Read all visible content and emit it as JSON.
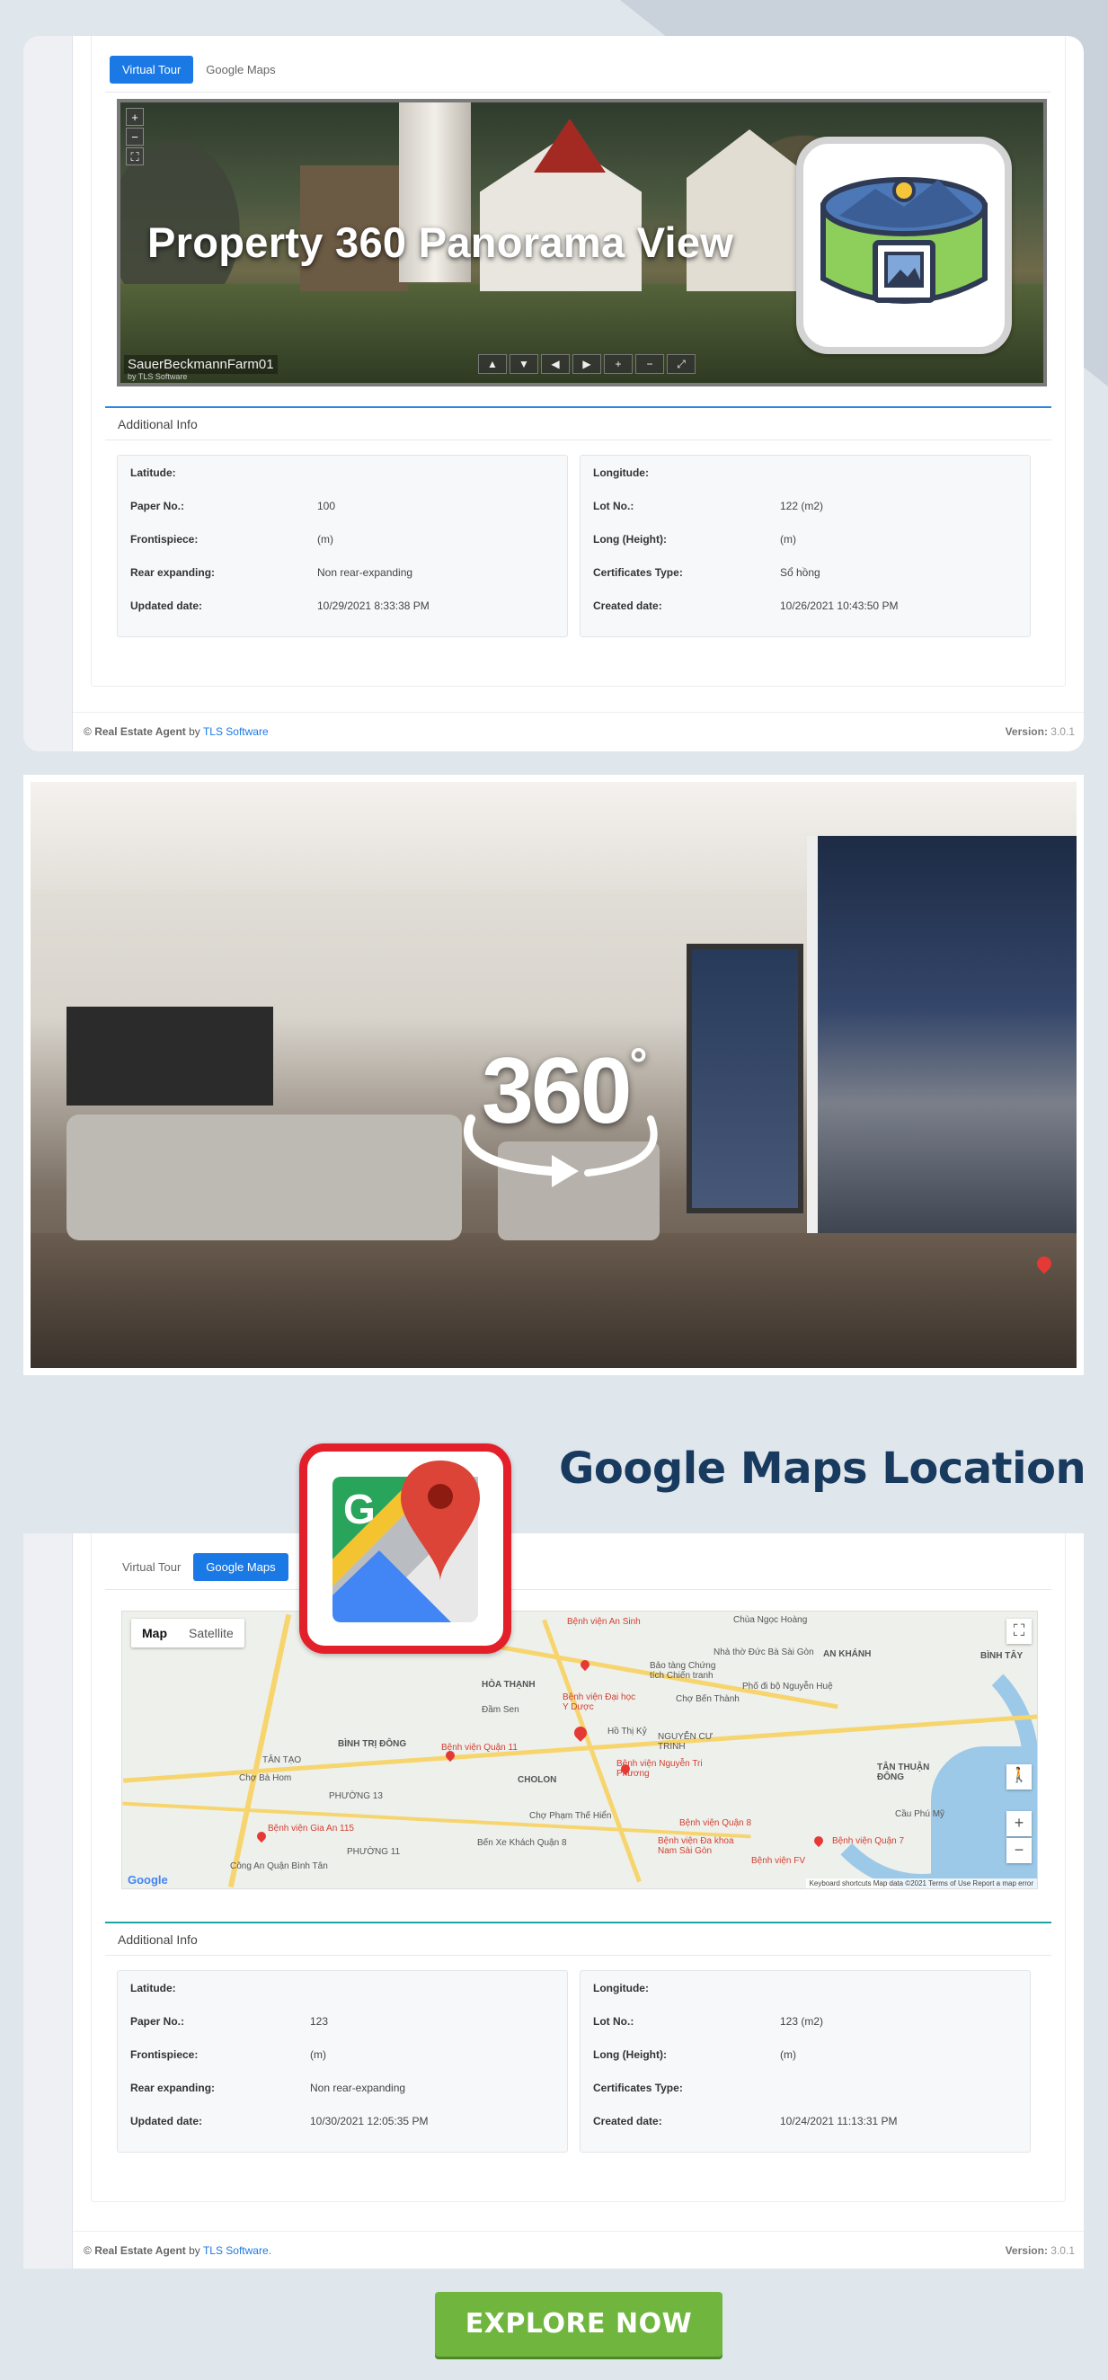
{
  "panel1": {
    "tabs": [
      {
        "label": "Virtual Tour",
        "active": true
      },
      {
        "label": "Google Maps",
        "active": false
      }
    ],
    "panorama": {
      "overlay_title": "Property 360 Panorama View",
      "scene_name": "SauerBeckmannFarm01",
      "credit": "by TLS Software",
      "zoom_buttons": [
        "+",
        "−",
        "⛶"
      ],
      "nav_buttons": [
        "▲",
        "▼",
        "◀",
        "▶",
        "+",
        "−",
        "⤢"
      ]
    },
    "section_title": "Additional Info",
    "left_info": [
      {
        "label": "Latitude:",
        "value": ""
      },
      {
        "label": "Paper No.:",
        "value": "100"
      },
      {
        "label": "Frontispiece:",
        "value": "(m)"
      },
      {
        "label": "Rear expanding:",
        "value": "Non rear-expanding"
      },
      {
        "label": "Updated date:",
        "value": "10/29/2021 8:33:38 PM"
      }
    ],
    "right_info": [
      {
        "label": "Longitude:",
        "value": ""
      },
      {
        "label": "Lot No.:",
        "value": "122 (m2)"
      },
      {
        "label": "Long (Height):",
        "value": "(m)"
      },
      {
        "label": "Certificates Type:",
        "value": "Sổ hồng"
      },
      {
        "label": "Created date:",
        "value": "10/26/2021 10:43:50 PM"
      }
    ],
    "footer": {
      "copyright": "©",
      "brand": "Real Estate Agent",
      "by": "by",
      "company": "TLS Software",
      "version_label": "Version:",
      "version": "3.0.1"
    }
  },
  "room_view": {
    "badge_text": "360",
    "badge_degree": "°"
  },
  "maps_heading": "Google Maps Location",
  "panel2": {
    "tabs": [
      {
        "label": "Virtual Tour",
        "active": false
      },
      {
        "label": "Google Maps",
        "active": true
      }
    ],
    "map": {
      "type_buttons": [
        "Map",
        "Satellite"
      ],
      "labels": [
        "Chùa Ngọc Hoàng",
        "Bệnh viện An Sinh",
        "Nhà thờ Đức Bà Sài Gòn",
        "AN KHÁNH",
        "Bảo tàng Chứng tích Chiến tranh",
        "Chợ Bến Thành",
        "Phố đi bộ Nguyễn Huệ",
        "HÒA THẠNH",
        "Đầm Sen",
        "Bệnh viện Đại học Y Dược",
        "Hồ Thị Kỷ",
        "NGUYỄN CƯ TRINH",
        "BÌNH TRỊ ĐÔNG",
        "Bệnh viện Quận 11",
        "CHOLON",
        "Bệnh viện Nguyễn Tri Phương",
        "TÂN TẠO",
        "Chợ Bà Hom",
        "PHƯỜNG 13",
        "Chợ Phạm Thế Hiển",
        "Bệnh viện Quận 8",
        "Bệnh viện Gia An 115",
        "Bến Xe Khách Quận 8",
        "Bệnh viện Đa khoa Nam Sài Gòn",
        "Bệnh viện Quận 7",
        "Bệnh viện FV",
        "Cầu Phú Mỹ",
        "TÂN THUẬN ĐÔNG",
        "BÌNH TÂY",
        "Công An Quận Bình Tân",
        "PHƯỜNG 11"
      ],
      "google": "Google",
      "attribution": "Keyboard shortcuts   Map data ©2021   Terms of Use   Report a map error",
      "zoom_in": "+",
      "zoom_out": "−",
      "fullscreen": "⛶"
    },
    "section_title": "Additional Info",
    "left_info": [
      {
        "label": "Latitude:",
        "value": ""
      },
      {
        "label": "Paper No.:",
        "value": "123"
      },
      {
        "label": "Frontispiece:",
        "value": "(m)"
      },
      {
        "label": "Rear expanding:",
        "value": "Non rear-expanding"
      },
      {
        "label": "Updated date:",
        "value": "10/30/2021 12:05:35 PM"
      }
    ],
    "right_info": [
      {
        "label": "Longitude:",
        "value": ""
      },
      {
        "label": "Lot No.:",
        "value": "123 (m2)"
      },
      {
        "label": "Long (Height):",
        "value": "(m)"
      },
      {
        "label": "Certificates Type:",
        "value": ""
      },
      {
        "label": "Created date:",
        "value": "10/24/2021 11:13:31 PM"
      }
    ],
    "footer": {
      "copyright": "©",
      "brand": "Real Estate Agent",
      "by": "by",
      "company": "TLS Software.",
      "version_label": "Version:",
      "version": "3.0.1"
    }
  },
  "cta": {
    "label": "EXPLORE NOW"
  },
  "colors": {
    "primary": "#1b79e6",
    "heading": "#173a5e",
    "cta": "#70b63e",
    "maps_red": "#e3202a"
  }
}
